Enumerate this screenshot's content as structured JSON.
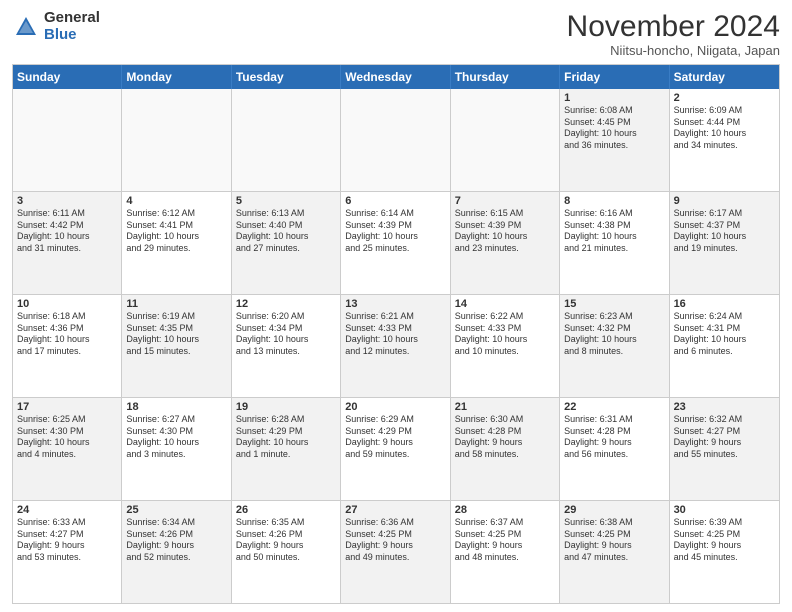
{
  "logo": {
    "general": "General",
    "blue": "Blue"
  },
  "title": "November 2024",
  "location": "Niitsu-honcho, Niigata, Japan",
  "headers": [
    "Sunday",
    "Monday",
    "Tuesday",
    "Wednesday",
    "Thursday",
    "Friday",
    "Saturday"
  ],
  "rows": [
    [
      {
        "day": "",
        "info": "",
        "empty": true
      },
      {
        "day": "",
        "info": "",
        "empty": true
      },
      {
        "day": "",
        "info": "",
        "empty": true
      },
      {
        "day": "",
        "info": "",
        "empty": true
      },
      {
        "day": "",
        "info": "",
        "empty": true
      },
      {
        "day": "1",
        "info": "Sunrise: 6:08 AM\nSunset: 4:45 PM\nDaylight: 10 hours\nand 36 minutes.",
        "shaded": true
      },
      {
        "day": "2",
        "info": "Sunrise: 6:09 AM\nSunset: 4:44 PM\nDaylight: 10 hours\nand 34 minutes.",
        "shaded": false
      }
    ],
    [
      {
        "day": "3",
        "info": "Sunrise: 6:11 AM\nSunset: 4:42 PM\nDaylight: 10 hours\nand 31 minutes.",
        "shaded": true
      },
      {
        "day": "4",
        "info": "Sunrise: 6:12 AM\nSunset: 4:41 PM\nDaylight: 10 hours\nand 29 minutes.",
        "shaded": false
      },
      {
        "day": "5",
        "info": "Sunrise: 6:13 AM\nSunset: 4:40 PM\nDaylight: 10 hours\nand 27 minutes.",
        "shaded": true
      },
      {
        "day": "6",
        "info": "Sunrise: 6:14 AM\nSunset: 4:39 PM\nDaylight: 10 hours\nand 25 minutes.",
        "shaded": false
      },
      {
        "day": "7",
        "info": "Sunrise: 6:15 AM\nSunset: 4:39 PM\nDaylight: 10 hours\nand 23 minutes.",
        "shaded": true
      },
      {
        "day": "8",
        "info": "Sunrise: 6:16 AM\nSunset: 4:38 PM\nDaylight: 10 hours\nand 21 minutes.",
        "shaded": false
      },
      {
        "day": "9",
        "info": "Sunrise: 6:17 AM\nSunset: 4:37 PM\nDaylight: 10 hours\nand 19 minutes.",
        "shaded": true
      }
    ],
    [
      {
        "day": "10",
        "info": "Sunrise: 6:18 AM\nSunset: 4:36 PM\nDaylight: 10 hours\nand 17 minutes.",
        "shaded": false
      },
      {
        "day": "11",
        "info": "Sunrise: 6:19 AM\nSunset: 4:35 PM\nDaylight: 10 hours\nand 15 minutes.",
        "shaded": true
      },
      {
        "day": "12",
        "info": "Sunrise: 6:20 AM\nSunset: 4:34 PM\nDaylight: 10 hours\nand 13 minutes.",
        "shaded": false
      },
      {
        "day": "13",
        "info": "Sunrise: 6:21 AM\nSunset: 4:33 PM\nDaylight: 10 hours\nand 12 minutes.",
        "shaded": true
      },
      {
        "day": "14",
        "info": "Sunrise: 6:22 AM\nSunset: 4:33 PM\nDaylight: 10 hours\nand 10 minutes.",
        "shaded": false
      },
      {
        "day": "15",
        "info": "Sunrise: 6:23 AM\nSunset: 4:32 PM\nDaylight: 10 hours\nand 8 minutes.",
        "shaded": true
      },
      {
        "day": "16",
        "info": "Sunrise: 6:24 AM\nSunset: 4:31 PM\nDaylight: 10 hours\nand 6 minutes.",
        "shaded": false
      }
    ],
    [
      {
        "day": "17",
        "info": "Sunrise: 6:25 AM\nSunset: 4:30 PM\nDaylight: 10 hours\nand 4 minutes.",
        "shaded": true
      },
      {
        "day": "18",
        "info": "Sunrise: 6:27 AM\nSunset: 4:30 PM\nDaylight: 10 hours\nand 3 minutes.",
        "shaded": false
      },
      {
        "day": "19",
        "info": "Sunrise: 6:28 AM\nSunset: 4:29 PM\nDaylight: 10 hours\nand 1 minute.",
        "shaded": true
      },
      {
        "day": "20",
        "info": "Sunrise: 6:29 AM\nSunset: 4:29 PM\nDaylight: 9 hours\nand 59 minutes.",
        "shaded": false
      },
      {
        "day": "21",
        "info": "Sunrise: 6:30 AM\nSunset: 4:28 PM\nDaylight: 9 hours\nand 58 minutes.",
        "shaded": true
      },
      {
        "day": "22",
        "info": "Sunrise: 6:31 AM\nSunset: 4:28 PM\nDaylight: 9 hours\nand 56 minutes.",
        "shaded": false
      },
      {
        "day": "23",
        "info": "Sunrise: 6:32 AM\nSunset: 4:27 PM\nDaylight: 9 hours\nand 55 minutes.",
        "shaded": true
      }
    ],
    [
      {
        "day": "24",
        "info": "Sunrise: 6:33 AM\nSunset: 4:27 PM\nDaylight: 9 hours\nand 53 minutes.",
        "shaded": false
      },
      {
        "day": "25",
        "info": "Sunrise: 6:34 AM\nSunset: 4:26 PM\nDaylight: 9 hours\nand 52 minutes.",
        "shaded": true
      },
      {
        "day": "26",
        "info": "Sunrise: 6:35 AM\nSunset: 4:26 PM\nDaylight: 9 hours\nand 50 minutes.",
        "shaded": false
      },
      {
        "day": "27",
        "info": "Sunrise: 6:36 AM\nSunset: 4:25 PM\nDaylight: 9 hours\nand 49 minutes.",
        "shaded": true
      },
      {
        "day": "28",
        "info": "Sunrise: 6:37 AM\nSunset: 4:25 PM\nDaylight: 9 hours\nand 48 minutes.",
        "shaded": false
      },
      {
        "day": "29",
        "info": "Sunrise: 6:38 AM\nSunset: 4:25 PM\nDaylight: 9 hours\nand 47 minutes.",
        "shaded": true
      },
      {
        "day": "30",
        "info": "Sunrise: 6:39 AM\nSunset: 4:25 PM\nDaylight: 9 hours\nand 45 minutes.",
        "shaded": false
      }
    ]
  ]
}
